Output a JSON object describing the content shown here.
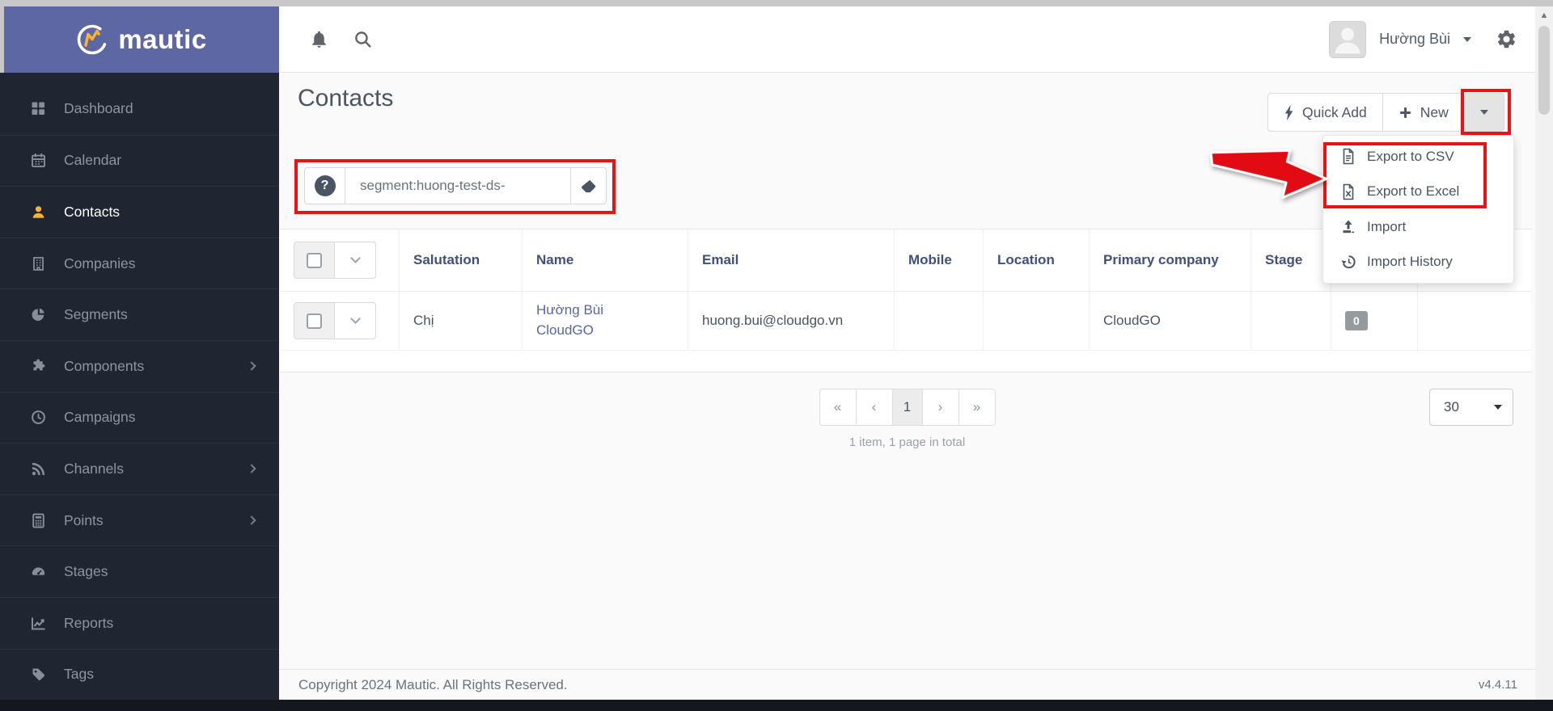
{
  "logo": {
    "text": "mautic"
  },
  "chrome": {
    "scroll_up_arrow": "▲"
  },
  "topbar": {
    "user_name": "Hường Bùi"
  },
  "sidebar": {
    "items": [
      {
        "label": "Dashboard"
      },
      {
        "label": "Calendar"
      },
      {
        "label": "Contacts"
      },
      {
        "label": "Companies"
      },
      {
        "label": "Segments"
      },
      {
        "label": "Components"
      },
      {
        "label": "Campaigns"
      },
      {
        "label": "Channels"
      },
      {
        "label": "Points"
      },
      {
        "label": "Stages"
      },
      {
        "label": "Reports"
      },
      {
        "label": "Tags"
      }
    ]
  },
  "page": {
    "title": "Contacts"
  },
  "toolbar": {
    "quick_add_label": "Quick Add",
    "new_label": "New"
  },
  "search": {
    "value": "segment:huong-test-ds-",
    "help_glyph": "?"
  },
  "dropdown": {
    "items": [
      {
        "label": "Export to CSV"
      },
      {
        "label": "Export to Excel"
      },
      {
        "label": "Import"
      },
      {
        "label": "Import History"
      }
    ]
  },
  "table": {
    "headers": [
      "Salutation",
      "Name",
      "Email",
      "Mobile",
      "Location",
      "Primary company",
      "Stage"
    ],
    "row": {
      "salutation": "Chị",
      "name_line1": "Hường Bùi",
      "name_line2": "CloudGO",
      "email": "huong.bui@cloudgo.vn",
      "mobile": "",
      "location": "",
      "primary_company": "CloudGO",
      "stage": "",
      "points_badge": "0"
    }
  },
  "pagination": {
    "buttons": [
      "«",
      "‹",
      "1",
      "›",
      "»"
    ],
    "summary": "1 item, 1 page in total",
    "page_size": "30"
  },
  "footer": {
    "copyright": "Copyright 2024 Mautic. All Rights Reserved.",
    "version": "v4.4.11"
  },
  "colors": {
    "brand_purple": "#5c67a3",
    "sidebar_bg": "#202631",
    "accent_yellow": "#f9b236",
    "annotation_red": "#ea1212",
    "header_blue": "#41507f",
    "link_blue": "#5767a5"
  }
}
